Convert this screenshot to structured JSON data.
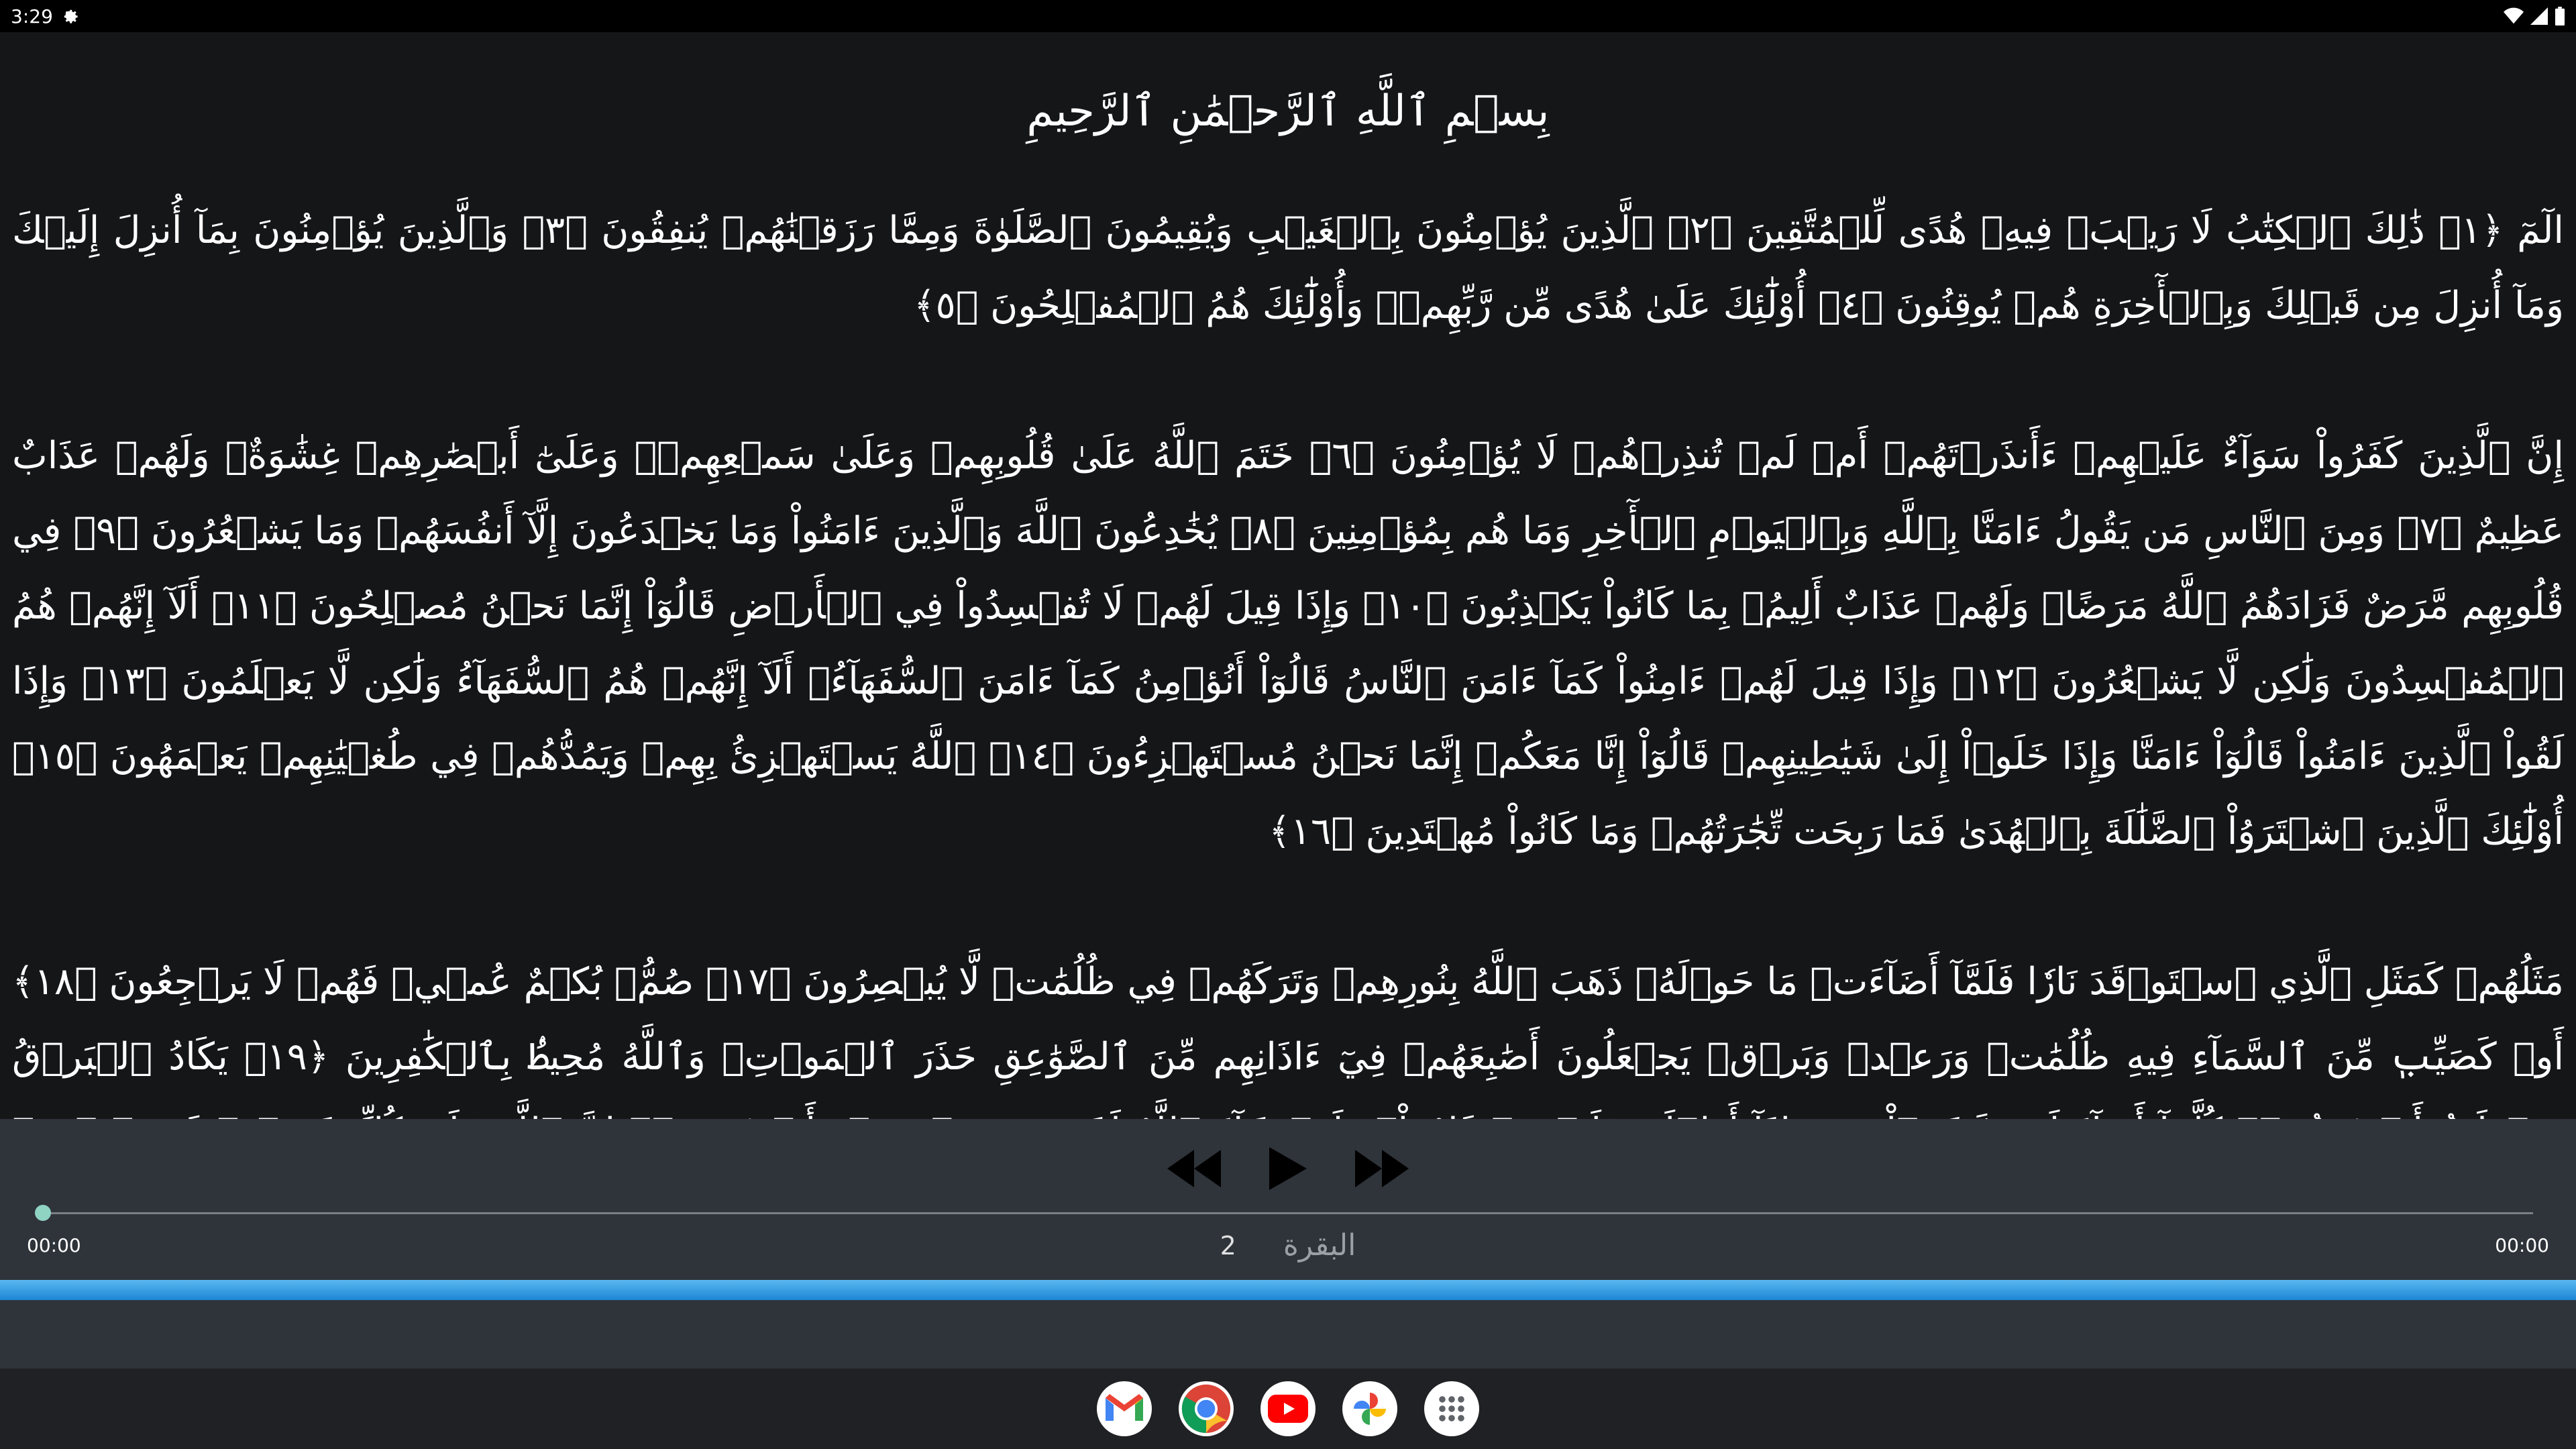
{
  "status": {
    "time": "3:29"
  },
  "reader": {
    "basmala": "بِسۡمِ ٱللَّهِ ٱلرَّحۡمَٰنِ ٱلرَّحِيمِ",
    "paragraphs": [
      "الٓمٓ ﴿١﴾ ذَٰلِكَ ٱلۡكِتَٰبُ لَا رَيۡبَۛ فِيهِۛ هُدًى لِّلۡمُتَّقِينَ ﴿٢﴾ ٱلَّذِينَ يُؤۡمِنُونَ بِٱلۡغَيۡبِ وَيُقِيمُونَ ٱلصَّلَوٰةَ وَمِمَّا رَزَقۡنَٰهُمۡ يُنفِقُونَ ﴿٣﴾ وَٱلَّذِينَ يُؤۡمِنُونَ بِمَآ أُنزِلَ إِلَيۡكَ وَمَآ أُنزِلَ مِن قَبۡلِكَ وَبِٱلۡأٓخِرَةِ هُمۡ يُوقِنُونَ ﴿٤﴾ أُوْلَٰٓئِكَ عَلَىٰ هُدًى مِّن رَّبِّهِمۡۖ وَأُوْلَٰٓئِكَ هُمُ ٱلۡمُفۡلِحُونَ ﴿٥﴾",
      "إِنَّ ٱلَّذِينَ كَفَرُواْ سَوَآءٌ عَلَيۡهِمۡ ءَأَنذَرۡتَهُمۡ أَمۡ لَمۡ تُنذِرۡهُمۡ لَا يُؤۡمِنُونَ ﴿٦﴾ خَتَمَ ٱللَّهُ عَلَىٰ قُلُوبِهِمۡ وَعَلَىٰ سَمۡعِهِمۡۖ وَعَلَىٰٓ أَبۡصَٰرِهِمۡ غِشَٰوَةٌۖ وَلَهُمۡ عَذَابٌ عَظِيمٌ ﴿٧﴾ وَمِنَ ٱلنَّاسِ مَن يَقُولُ ءَامَنَّا بِٱللَّهِ وَبِٱلۡيَوۡمِ ٱلۡأٓخِرِ وَمَا هُم بِمُؤۡمِنِينَ ﴿٨﴾ يُخَٰدِعُونَ ٱللَّهَ وَٱلَّذِينَ ءَامَنُواْ وَمَا يَخۡدَعُونَ إِلَّآ أَنفُسَهُمۡ وَمَا يَشۡعُرُونَ ﴿٩﴾ فِي قُلُوبِهِم مَّرَضٌ فَزَادَهُمُ ٱللَّهُ مَرَضًاۖ وَلَهُمۡ عَذَابٌ أَلِيمُۢ بِمَا كَانُواْ يَكۡذِبُونَ ﴿١٠﴾ وَإِذَا قِيلَ لَهُمۡ لَا تُفۡسِدُواْ فِي ٱلۡأَرۡضِ قَالُوٓاْ إِنَّمَا نَحۡنُ مُصۡلِحُونَ ﴿١١﴾ أَلَآ إِنَّهُمۡ هُمُ ٱلۡمُفۡسِدُونَ وَلَٰكِن لَّا يَشۡعُرُونَ ﴿١٢﴾ وَإِذَا قِيلَ لَهُمۡ ءَامِنُواْ كَمَآ ءَامَنَ ٱلنَّاسُ قَالُوٓاْ أَنُؤۡمِنُ كَمَآ ءَامَنَ ٱلسُّفَهَآءُۗ أَلَآ إِنَّهُمۡ هُمُ ٱلسُّفَهَآءُ وَلَٰكِن لَّا يَعۡلَمُونَ ﴿١٣﴾ وَإِذَا لَقُواْ ٱلَّذِينَ ءَامَنُواْ قَالُوٓاْ ءَامَنَّا وَإِذَا خَلَوۡاْ إِلَىٰ شَيَٰطِينِهِمۡ قَالُوٓاْ إِنَّا مَعَكُمۡ إِنَّمَا نَحۡنُ مُسۡتَهۡزِءُونَ ﴿١٤﴾ ٱللَّهُ يَسۡتَهۡزِئُ بِهِمۡ وَيَمُدُّهُمۡ فِي طُغۡيَٰنِهِمۡ يَعۡمَهُونَ ﴿١٥﴾ أُوْلَٰٓئِكَ ٱلَّذِينَ ٱشۡتَرَوُاْ ٱلضَّلَٰلَةَ بِٱلۡهُدَىٰ فَمَا رَبِحَت تِّجَٰرَتُهُمۡ وَمَا كَانُواْ مُهۡتَدِينَ ﴿١٦﴾",
      "مَثَلُهُمۡ كَمَثَلِ ٱلَّذِي ٱسۡتَوۡقَدَ نَارٗا فَلَمَّآ أَضَآءَتۡ مَا حَوۡلَهُۥ ذَهَبَ ٱللَّهُ بِنُورِهِمۡ وَتَرَكَهُمۡ فِي ظُلُمَٰتٖ لَّا يُبۡصِرُونَ ﴿١٧﴾ صُمُّۢ بُكۡمٌ عُمۡيٞ فَهُمۡ لَا يَرۡجِعُونَ ﴿١٨﴾ أَوۡ كَصَيِّبٖ مِّنَ ٱلسَّمَآءِ فِيهِ ظُلُمَٰتٞ وَرَعۡدٞ وَبَرۡقٞ يَجۡعَلُونَ أَصَٰبِعَهُمۡ فِيٓ ءَاذَانِهِم مِّنَ ٱلصَّوَٰعِقِ حَذَرَ ٱلۡمَوۡتِۚ وَٱللَّهُ مُحِيطُۢ بِٱلۡكَٰفِرِينَ ﴿١٩﴾ يَكَادُ ٱلۡبَرۡقُ يَخۡطَفُ أَبۡصَٰرَهُمۡۖ كُلَّمَآ أَضَآءَ لَهُم مَّشَوۡاْ فِيهِ وَإِذَآ أَظۡلَمَ عَلَيۡهِمۡ قَامُواْۚ وَلَوۡ شَآءَ ٱللَّهُ لَذَهَبَ بِسَمۡعِهِمۡ وَأَبۡصَٰرِهِمۡۚ إِنَّ ٱللَّهَ عَلَىٰ كُلِّ شَيۡءٖ قَدِيرٞ ﴿٢٠﴾ يَٰٓأَيُّهَا ٱلنَّاسُ ٱعۡبُدُواْ رَبَّكُمُ ٱلَّذِي خَلَقَكُمۡ وَٱلَّذِينَ مِن قَبۡلِكُمۡ لَعَلَّكُمۡ تَتَّقُونَ ﴿٢١﴾ ٱلَّذِي جَعَلَ لَكُمُ ٱلۡأَرۡضَ فِرَٰشٗا وَٱلسَّمَآءَ بِنَآءٗ وَأَنزَلَ مِنَ ٱلسَّمَآءِ مَآءٗ فَأَخۡرَجَ بِهِۦ مِنَ ٱلثَّمَرَٰتِ رِزۡقٗا"
    ]
  },
  "player": {
    "time_current": "00:00",
    "time_total": "00:00",
    "surah_number": "2",
    "surah_name": "البقرة",
    "progress": 0
  },
  "colors": {
    "background": "#151618",
    "player_bg": "#2f343a",
    "accent": "#8fd3c3",
    "loading": "#2196f3"
  },
  "taskbar": {
    "apps": [
      "gmail-icon",
      "chrome-icon",
      "youtube-icon",
      "photos-icon",
      "app-drawer-icon"
    ]
  }
}
